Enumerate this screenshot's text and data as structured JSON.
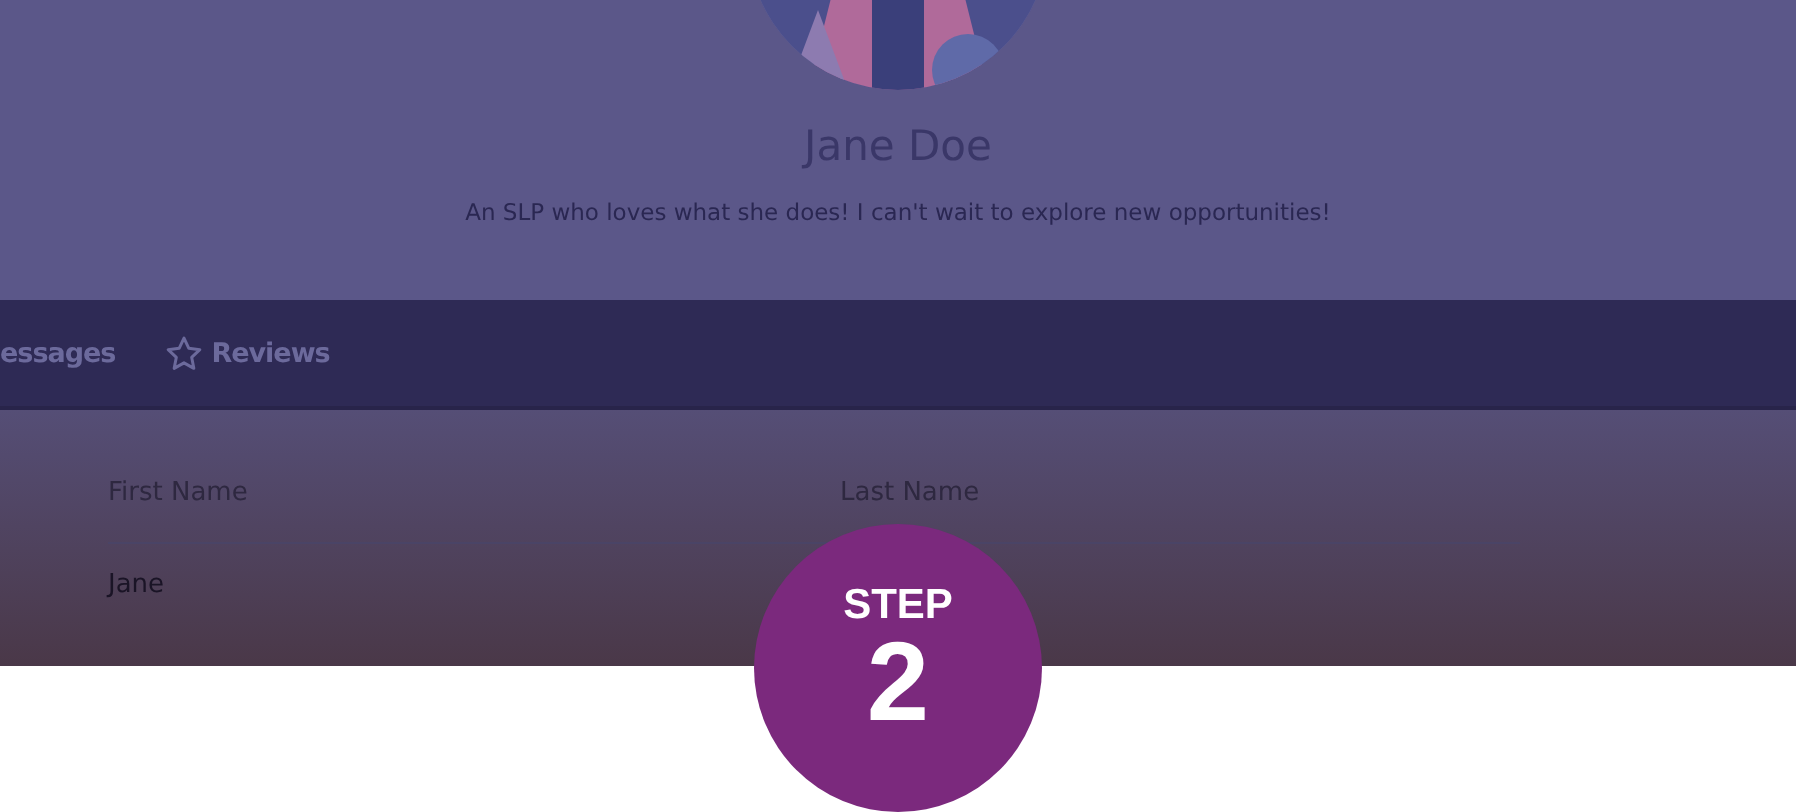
{
  "profile": {
    "name": "Jane Doe",
    "bio": "An SLP who loves what she does! I can't wait to explore new opportunities!"
  },
  "tabs": [
    {
      "label": "essages",
      "kind": "plain"
    },
    {
      "label": "Reviews",
      "kind": "starred"
    }
  ],
  "fields": {
    "columns": [
      "First Name",
      "Last Name"
    ],
    "rows": [
      [
        "Jane"
      ]
    ]
  },
  "badge": {
    "label": "STEP",
    "number": "2"
  }
}
